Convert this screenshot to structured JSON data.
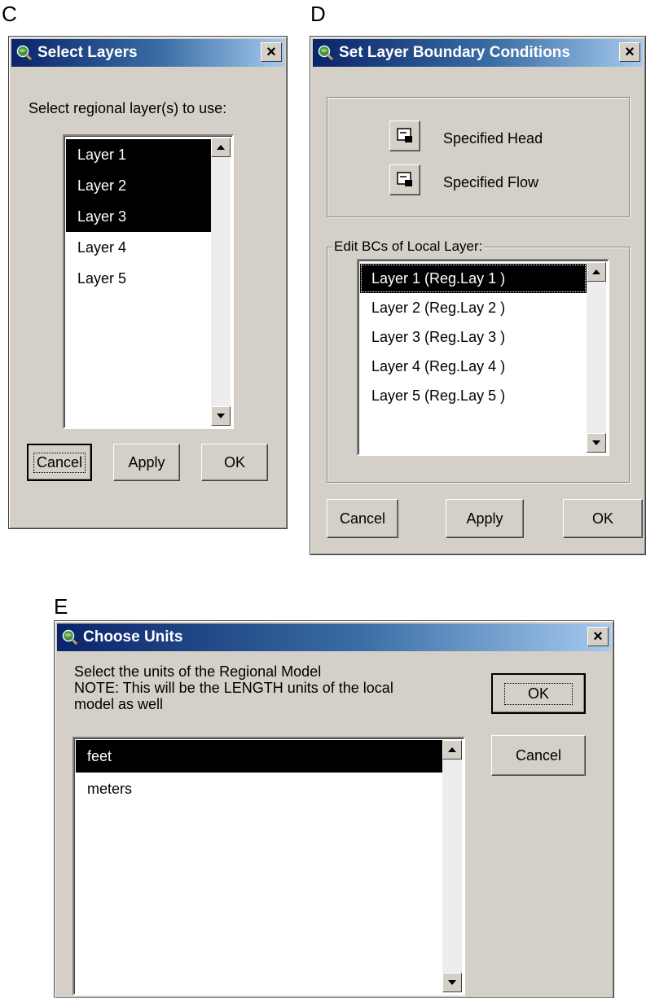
{
  "figure_labels": {
    "c": "C",
    "d": "D",
    "e": "E"
  },
  "select_layers": {
    "title": "Select Layers",
    "close": "×",
    "prompt": "Select regional layer(s) to use:",
    "items": [
      "Layer 1",
      "Layer 2",
      "Layer 3",
      "Layer 4",
      "Layer 5"
    ],
    "selected": [
      0,
      1,
      2
    ],
    "buttons": {
      "cancel": "Cancel",
      "apply": "Apply",
      "ok": "OK"
    }
  },
  "boundary_conditions": {
    "title": "Set Layer Boundary Conditions",
    "close": "×",
    "specified_head": "Specified Head",
    "specified_flow": "Specified Flow",
    "group_label": "Edit BCs of Local Layer:",
    "items": [
      "Layer 1 (Reg.Lay 1 )",
      "Layer 2 (Reg.Lay 2 )",
      "Layer 3 (Reg.Lay 3 )",
      "Layer 4 (Reg.Lay 4 )",
      "Layer 5 (Reg.Lay 5 )"
    ],
    "selected": [
      0
    ],
    "buttons": {
      "cancel": "Cancel",
      "apply": "Apply",
      "ok": "OK"
    }
  },
  "choose_units": {
    "title": "Choose Units",
    "close": "×",
    "prompt_line1": "Select the units of the Regional Model",
    "prompt_line2": "NOTE: This will be the LENGTH units of the local",
    "prompt_line3": "model as well",
    "items": [
      "feet",
      "meters"
    ],
    "selected": [
      0
    ],
    "buttons": {
      "ok": "OK",
      "cancel": "Cancel"
    }
  },
  "icons": {
    "app": "app-globe-magnifier-icon",
    "bc_tool": "boundary-tool-icon"
  }
}
